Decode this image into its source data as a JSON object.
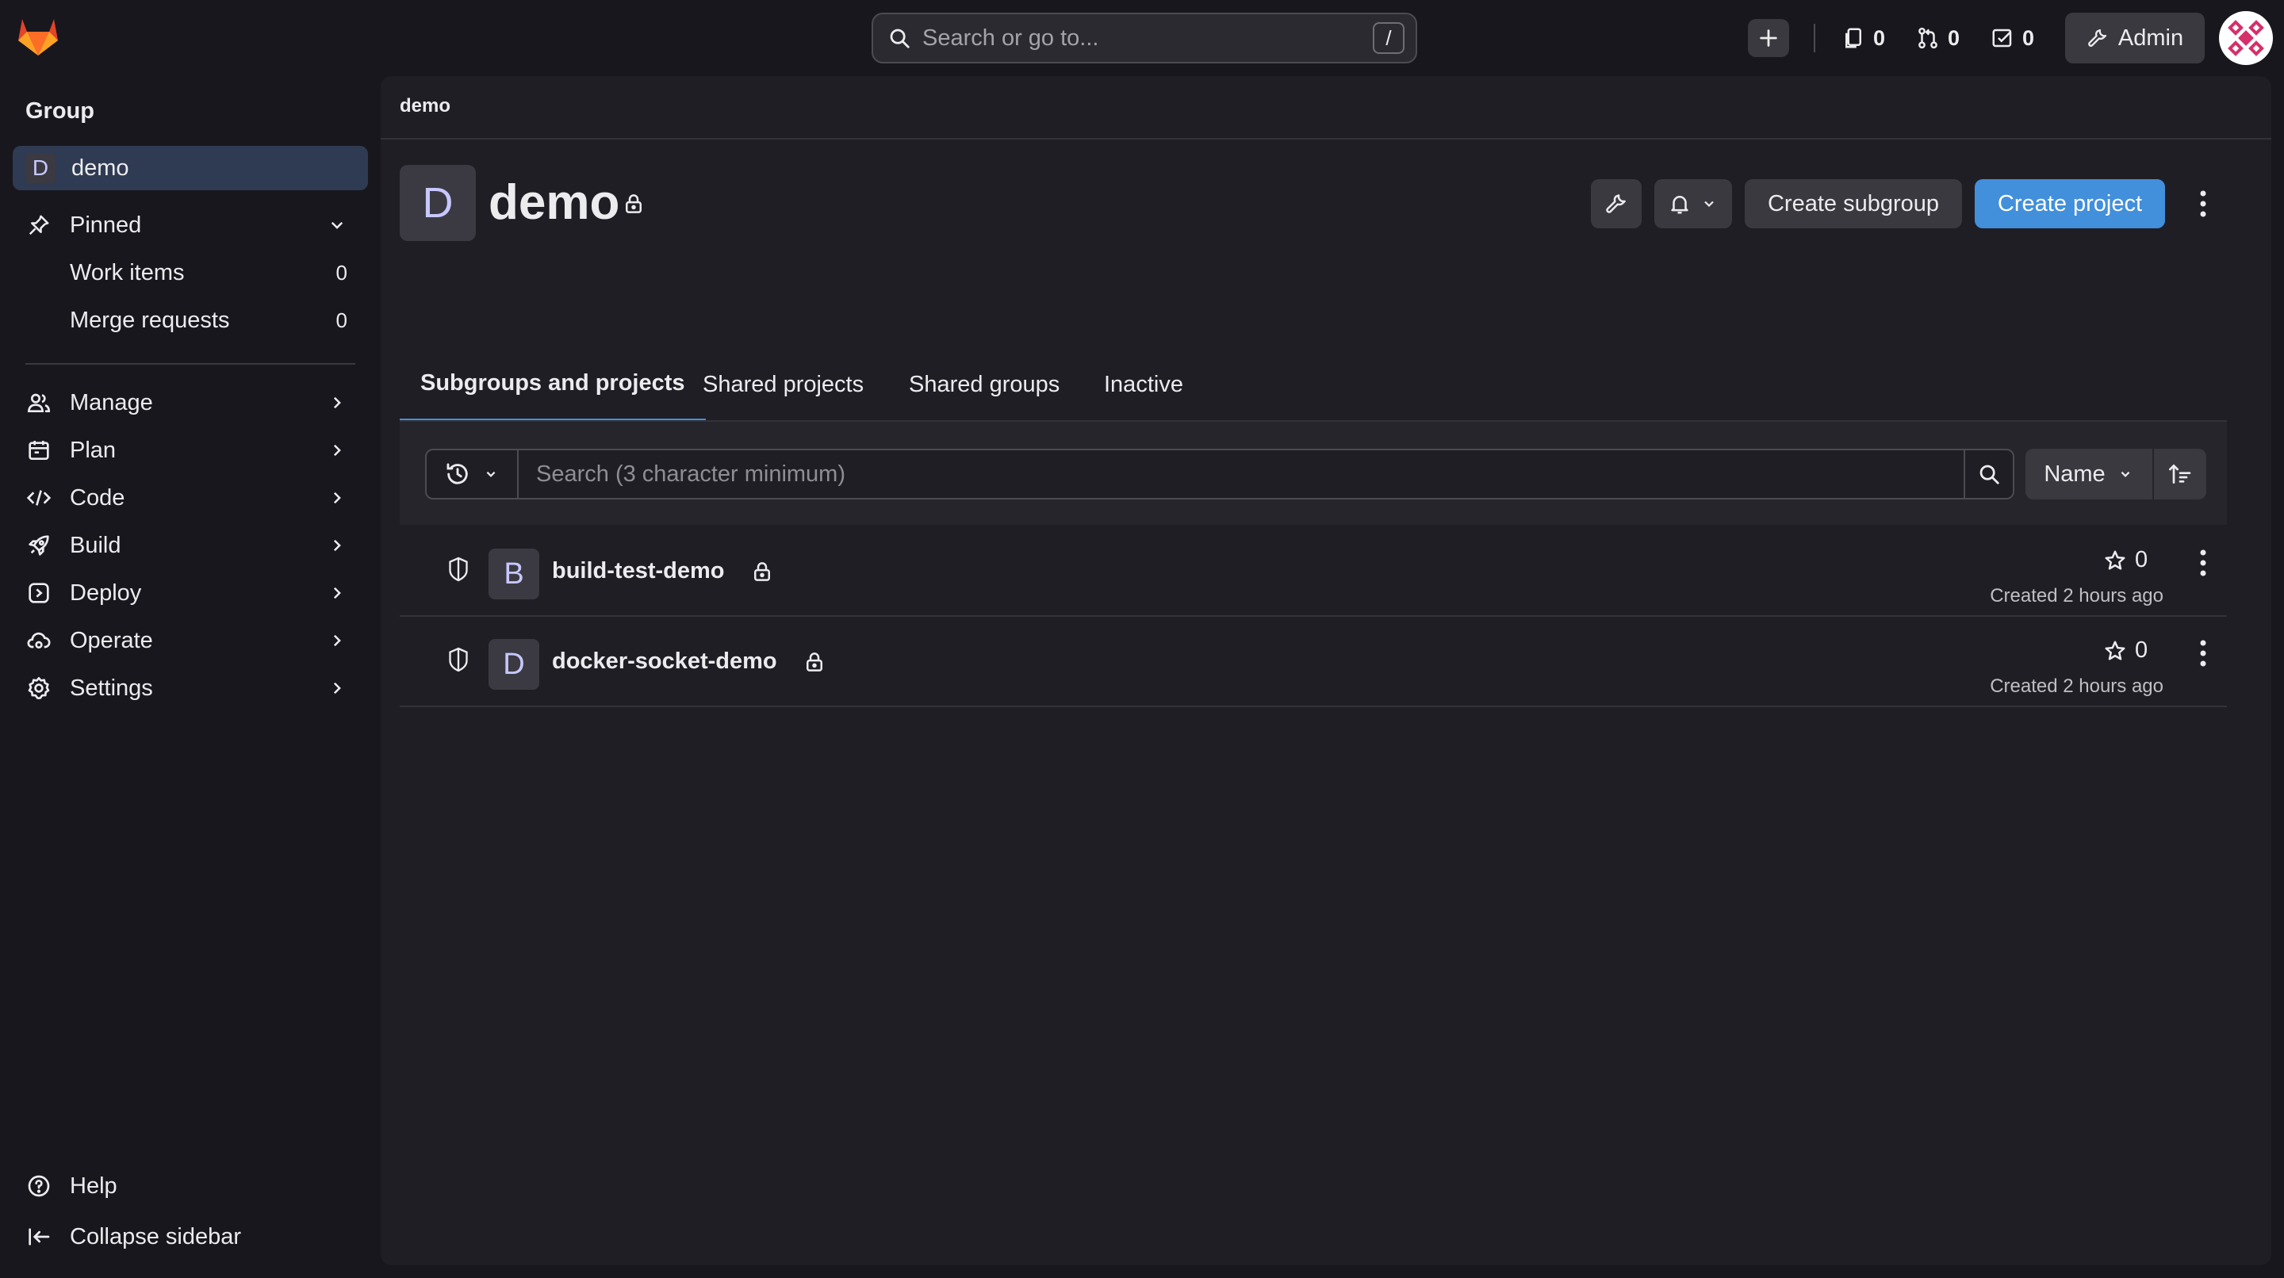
{
  "topbar": {
    "search_placeholder": "Search or go to...",
    "search_shortcut": "/",
    "issues_count": "0",
    "merge_requests_count": "0",
    "todos_count": "0",
    "admin_label": "Admin"
  },
  "sidebar": {
    "section_title": "Group",
    "current_group": {
      "initial": "D",
      "label": "demo"
    },
    "pinned": {
      "label": "Pinned",
      "items": [
        {
          "label": "Work items",
          "count": "0"
        },
        {
          "label": "Merge requests",
          "count": "0"
        }
      ]
    },
    "nav": [
      {
        "label": "Manage",
        "icon": "users-icon"
      },
      {
        "label": "Plan",
        "icon": "calendar-icon"
      },
      {
        "label": "Code",
        "icon": "code-icon"
      },
      {
        "label": "Build",
        "icon": "rocket-icon"
      },
      {
        "label": "Deploy",
        "icon": "deploy-icon"
      },
      {
        "label": "Operate",
        "icon": "cloud-gear-icon"
      },
      {
        "label": "Settings",
        "icon": "gear-icon"
      }
    ],
    "help_label": "Help",
    "collapse_label": "Collapse sidebar"
  },
  "main": {
    "breadcrumb": "demo",
    "group": {
      "initial": "D",
      "title": "demo"
    },
    "create_subgroup_label": "Create subgroup",
    "create_project_label": "Create project",
    "tabs": [
      {
        "label": "Subgroups and projects",
        "active": true
      },
      {
        "label": "Shared projects",
        "active": false
      },
      {
        "label": "Shared groups",
        "active": false
      },
      {
        "label": "Inactive",
        "active": false
      }
    ],
    "filter": {
      "placeholder": "Search (3 character minimum)",
      "sort_label": "Name"
    },
    "projects": [
      {
        "initial": "B",
        "name": "build-test-demo",
        "stars": "0",
        "created": "Created 2 hours ago"
      },
      {
        "initial": "D",
        "name": "docker-socket-demo",
        "stars": "0",
        "created": "Created 2 hours ago"
      }
    ]
  },
  "colors": {
    "background": "#18171d",
    "panel": "#1f1e24",
    "primary_button": "#428fdc",
    "active_nav": "#2f3b52",
    "logo_orange": "#fc6d26"
  }
}
